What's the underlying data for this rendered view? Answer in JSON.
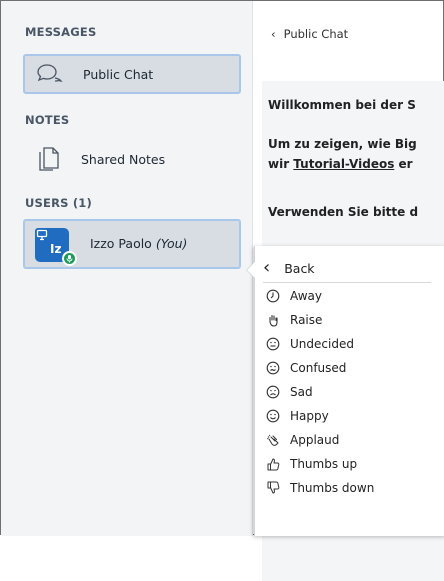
{
  "sidebar": {
    "messages_title": "MESSAGES",
    "public_chat_label": "Public Chat",
    "notes_title": "NOTES",
    "shared_notes_label": "Shared Notes",
    "users_title": "USERS (1)",
    "user": {
      "initials": "Iz",
      "name": "Izzo Paolo",
      "you_label": "(You)"
    }
  },
  "chat": {
    "header": "Public Chat",
    "line1": "Willkommen bei der S",
    "line2": "Um zu zeigen, wie Big",
    "line3_prefix": "wir ",
    "line3_link": "Tutorial-Videos",
    "line3_suffix": " er",
    "line4": "Verwenden Sie bitte d"
  },
  "status_menu": {
    "back_label": "Back",
    "items": [
      {
        "label": "Away",
        "icon": "clock-icon"
      },
      {
        "label": "Raise",
        "icon": "raised-hand-icon"
      },
      {
        "label": "Undecided",
        "icon": "neutral-face-icon"
      },
      {
        "label": "Confused",
        "icon": "confused-face-icon"
      },
      {
        "label": "Sad",
        "icon": "sad-face-icon"
      },
      {
        "label": "Happy",
        "icon": "happy-face-icon"
      },
      {
        "label": "Applaud",
        "icon": "clapping-hands-icon"
      },
      {
        "label": "Thumbs up",
        "icon": "thumbs-up-icon"
      },
      {
        "label": "Thumbs down",
        "icon": "thumbs-down-icon"
      }
    ]
  },
  "colors": {
    "accent": "#1f6cc0",
    "mic_green": "#1f9a5a",
    "active_border": "#a9c7ea"
  }
}
